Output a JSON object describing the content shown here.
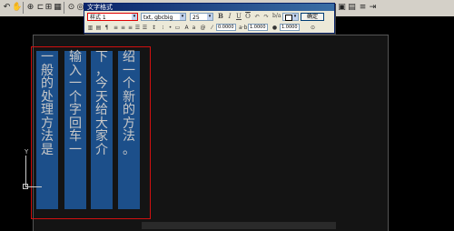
{
  "window": {
    "dialog_title": "文字格式"
  },
  "app_toolbar": {
    "icons": [
      "undo-icon",
      "pan-icon",
      "zoom-icon",
      "ortho-icon",
      "snap-icon",
      "grid-icon",
      "osnap-icon",
      "polar-icon",
      "block-icon",
      "properties-icon",
      "layer-icon",
      "match-icon"
    ]
  },
  "text_format": {
    "style_value": "样式 1",
    "font_value": "txt, gbcbig",
    "height_value": "25",
    "bold_label": "B",
    "italic_label": "I",
    "underline_label": "U",
    "overline_label": "O",
    "undo_label": "↶",
    "redo_label": "↷",
    "stack_label": "b/a",
    "color_value": "",
    "ok_label": "确定",
    "options_label": "⊙",
    "oblique_value": "0.0000",
    "tracking_value": "1.0000",
    "width_value": "1.0000"
  },
  "mtext": {
    "columns": [
      "一般的处理方法是",
      "输入一个字回车一",
      "下，今天给大家介",
      "绍一个新的方法。"
    ]
  },
  "ucs": {
    "y_label": "Y"
  },
  "colors": {
    "selection_blue": "#1c4f8a",
    "window_red": "#d01010",
    "canvas": "#000000"
  }
}
